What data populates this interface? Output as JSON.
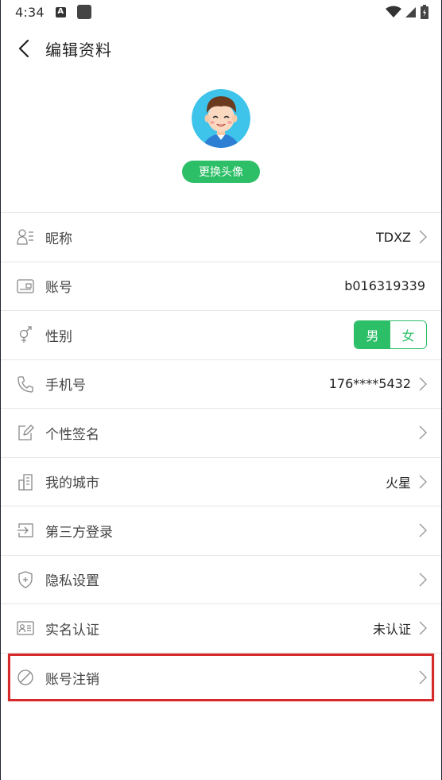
{
  "status_bar": {
    "time": "4:34",
    "notif_letter": "A"
  },
  "header": {
    "title": "编辑资料"
  },
  "avatar": {
    "button_label": "更换头像"
  },
  "rows": [
    {
      "key": "nickname",
      "label": "昵称",
      "value": "TDXZ"
    },
    {
      "key": "account",
      "label": "账号",
      "value": "b016319339"
    },
    {
      "key": "gender",
      "label": "性别",
      "options": [
        "男",
        "女"
      ],
      "selected": "男"
    },
    {
      "key": "phone",
      "label": "手机号",
      "value": "176****5432"
    },
    {
      "key": "signature",
      "label": "个性签名",
      "value": ""
    },
    {
      "key": "city",
      "label": "我的城市",
      "value": "火星"
    },
    {
      "key": "third-party-login",
      "label": "第三方登录",
      "value": ""
    },
    {
      "key": "privacy",
      "label": "隐私设置",
      "value": ""
    },
    {
      "key": "real-name",
      "label": "实名认证",
      "value": "未认证"
    },
    {
      "key": "deactivate",
      "label": "账号注销",
      "value": ""
    }
  ],
  "colors": {
    "accent": "#2dbf67",
    "avatar_bg": "#3ec3ea",
    "highlight": "#d62a2a"
  }
}
